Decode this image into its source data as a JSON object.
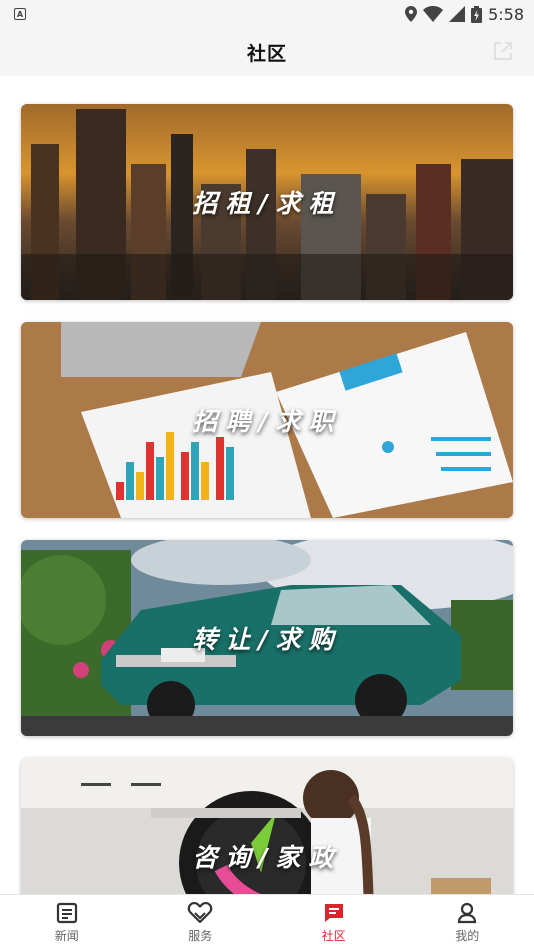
{
  "status_bar": {
    "time": "5:58",
    "notification_icon": "a-icon"
  },
  "header": {
    "title": "社区",
    "share_icon": "share-icon"
  },
  "cards": [
    {
      "label": "招租/求租",
      "image": "city-skyline-image"
    },
    {
      "label": "招聘/求职",
      "image": "resume-documents-image"
    },
    {
      "label": "转让/求购",
      "image": "classic-car-image"
    },
    {
      "label": "咨询/家政",
      "image": "housekeeping-image"
    }
  ],
  "tabbar": {
    "active_color": "#d8262c",
    "items": [
      {
        "label": "新闻",
        "icon": "news-icon",
        "active": false
      },
      {
        "label": "服务",
        "icon": "heart-icon",
        "active": false
      },
      {
        "label": "社区",
        "icon": "chat-icon",
        "active": true
      },
      {
        "label": "我的",
        "icon": "user-icon",
        "active": false
      }
    ]
  }
}
